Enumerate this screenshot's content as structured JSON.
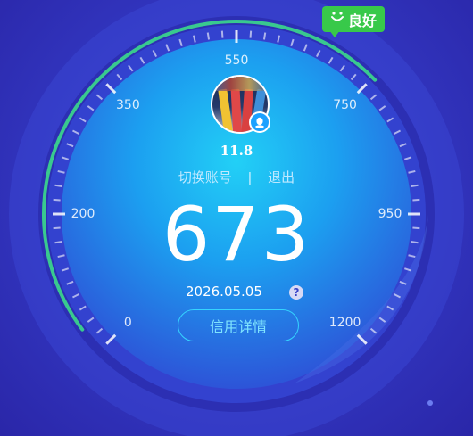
{
  "gauge": {
    "scale_labels": [
      "0",
      "200",
      "350",
      "550",
      "750",
      "950",
      "1200"
    ],
    "progress_fraction": 0.67,
    "progress_color": "#39c98f",
    "tick_color": "#ffffff"
  },
  "profile": {
    "value": "11.8",
    "switch_account_label": "切换账号",
    "separator": "|",
    "logout_label": "退出"
  },
  "score": {
    "value": "673",
    "date": "2026.05.05",
    "help": "?"
  },
  "rating_badge": {
    "label": "良好",
    "color": "#38c94a"
  },
  "detail_button": {
    "label": "信用详情"
  },
  "colors": {
    "background": "#3236c0",
    "dial_inner": "#1e9cf0",
    "button_border": "#35d4ff"
  }
}
